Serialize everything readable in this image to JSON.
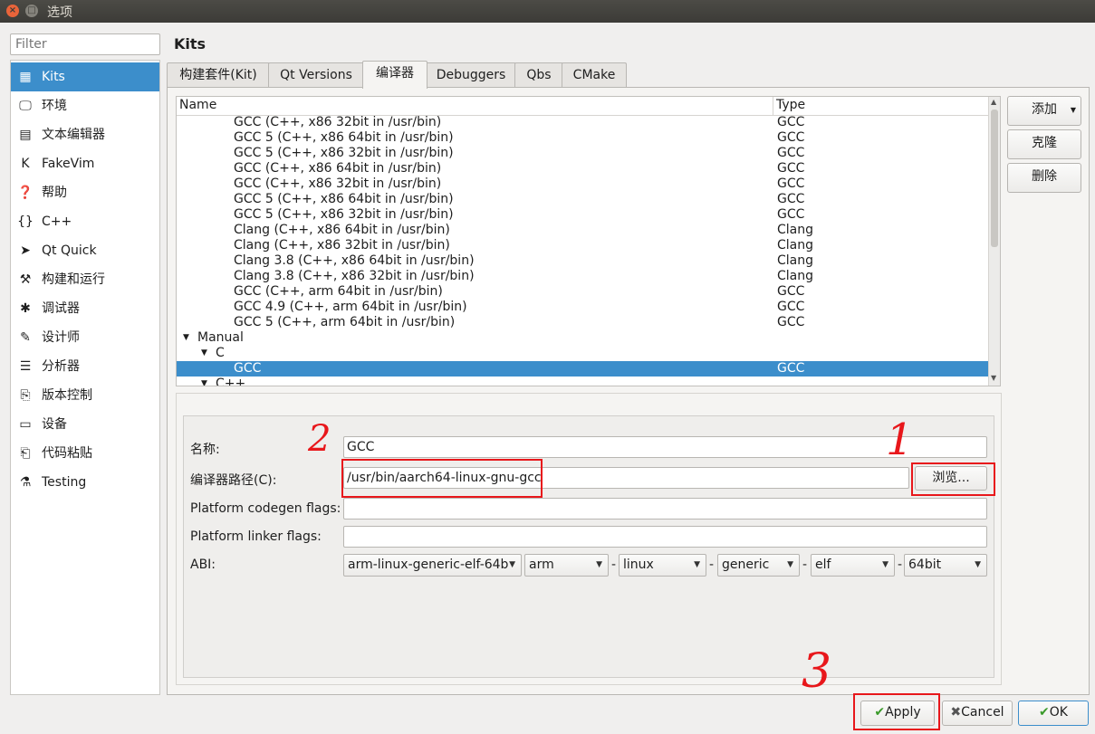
{
  "window": {
    "title": "选项"
  },
  "filter": {
    "placeholder": "Filter"
  },
  "nav": [
    {
      "label": "Kits",
      "icon": "kits-icon",
      "glyph": "▦"
    },
    {
      "label": "环境",
      "icon": "monitor-icon",
      "glyph": "🖵"
    },
    {
      "label": "文本编辑器",
      "icon": "text-editor-icon",
      "glyph": "▤"
    },
    {
      "label": "FakeVim",
      "icon": "fakevim-icon",
      "glyph": "K"
    },
    {
      "label": "帮助",
      "icon": "help-icon",
      "glyph": "❓"
    },
    {
      "label": "C++",
      "icon": "braces-icon",
      "glyph": "{}"
    },
    {
      "label": "Qt Quick",
      "icon": "qt-quick-icon",
      "glyph": "➤"
    },
    {
      "label": "构建和运行",
      "icon": "hammer-icon",
      "glyph": "⚒"
    },
    {
      "label": "调试器",
      "icon": "bug-icon",
      "glyph": "✱"
    },
    {
      "label": "设计师",
      "icon": "pencil-icon",
      "glyph": "✎"
    },
    {
      "label": "分析器",
      "icon": "analyzer-icon",
      "glyph": "☰"
    },
    {
      "label": "版本控制",
      "icon": "version-control-icon",
      "glyph": "⎘"
    },
    {
      "label": "设备",
      "icon": "device-icon",
      "glyph": "▭"
    },
    {
      "label": "代码粘贴",
      "icon": "paste-icon",
      "glyph": "⎗"
    },
    {
      "label": "Testing",
      "icon": "testing-icon",
      "glyph": "⚗"
    }
  ],
  "page_title": "Kits",
  "tabs": [
    "构建套件(Kit)",
    "Qt Versions",
    "编译器",
    "Debuggers",
    "Qbs",
    "CMake"
  ],
  "tree": {
    "col_name": "Name",
    "col_type": "Type",
    "auto_rows": [
      {
        "name": "GCC (C++, x86 32bit in /usr/bin)",
        "type": "GCC"
      },
      {
        "name": "GCC 5 (C++, x86 64bit in /usr/bin)",
        "type": "GCC"
      },
      {
        "name": "GCC 5 (C++, x86 32bit in /usr/bin)",
        "type": "GCC"
      },
      {
        "name": "GCC (C++, x86 64bit in /usr/bin)",
        "type": "GCC"
      },
      {
        "name": "GCC (C++, x86 32bit in /usr/bin)",
        "type": "GCC"
      },
      {
        "name": "GCC 5 (C++, x86 64bit in /usr/bin)",
        "type": "GCC"
      },
      {
        "name": "GCC 5 (C++, x86 32bit in /usr/bin)",
        "type": "GCC"
      },
      {
        "name": "Clang (C++, x86 64bit in /usr/bin)",
        "type": "Clang"
      },
      {
        "name": "Clang (C++, x86 32bit in /usr/bin)",
        "type": "Clang"
      },
      {
        "name": "Clang 3.8 (C++, x86 64bit in /usr/bin)",
        "type": "Clang"
      },
      {
        "name": "Clang 3.8 (C++, x86 32bit in /usr/bin)",
        "type": "Clang"
      },
      {
        "name": "GCC (C++, arm 64bit in /usr/bin)",
        "type": "GCC"
      },
      {
        "name": "GCC 4.9 (C++, arm 64bit in /usr/bin)",
        "type": "GCC"
      },
      {
        "name": "GCC 5 (C++, arm 64bit in /usr/bin)",
        "type": "GCC"
      }
    ],
    "manual_label": "Manual",
    "c_label": "C",
    "selected_name": "GCC",
    "selected_type": "GCC",
    "cpp_label": "C++"
  },
  "side_buttons": {
    "add": "添加",
    "clone": "克隆",
    "remove": "删除"
  },
  "form": {
    "name_label": "名称:",
    "name_value": "GCC",
    "path_label": "编译器路径(C):",
    "path_value": "/usr/bin/aarch64-linux-gnu-gcc",
    "browse": "浏览...",
    "codegen_label": "Platform codegen flags:",
    "codegen_value": "",
    "linker_label": "Platform linker flags:",
    "linker_value": "",
    "abi_label": "ABI:",
    "abi_main": "arm-linux-generic-elf-64b",
    "abi_arch": "arm",
    "abi_os": "linux",
    "abi_flavor": "generic",
    "abi_format": "elf",
    "abi_width": "64bit",
    "dash": "-"
  },
  "buttons": {
    "apply": "Apply",
    "cancel": "Cancel",
    "ok": "OK"
  },
  "annotations": {
    "one": "1",
    "two": "2",
    "three": "3"
  },
  "colors": {
    "selection": "#3c8ecb",
    "annotation": "#e8171b"
  }
}
